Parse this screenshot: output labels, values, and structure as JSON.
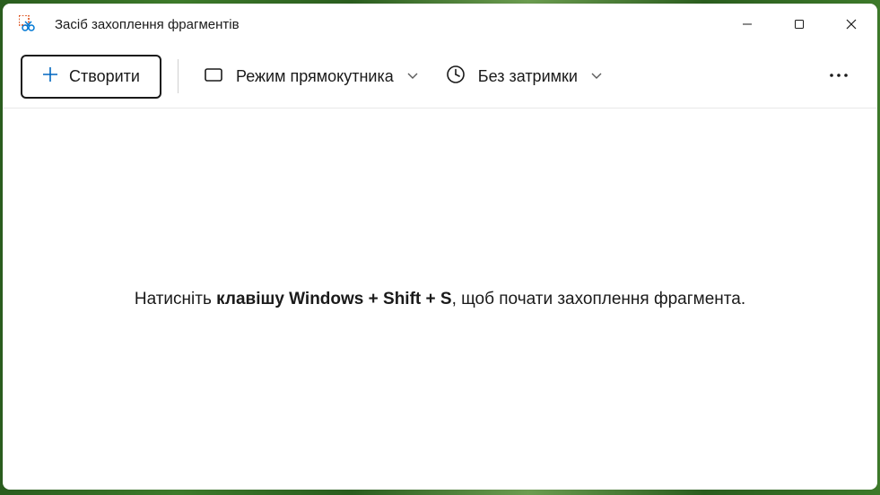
{
  "titlebar": {
    "title": "Засіб захоплення фрагментів"
  },
  "toolbar": {
    "new_label": "Створити",
    "mode_label": "Режим прямокутника",
    "delay_label": "Без затримки"
  },
  "content": {
    "hint_prefix": "Натисніть ",
    "hint_bold": "клавішу Windows + Shift + S",
    "hint_suffix": ", щоб почати захоплення фрагмента."
  }
}
